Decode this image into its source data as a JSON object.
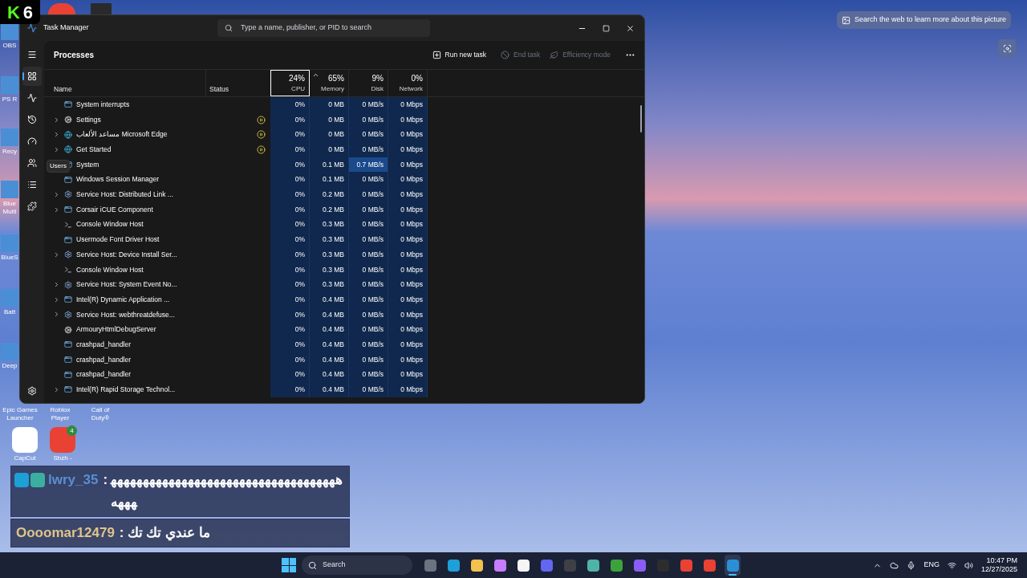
{
  "overlay_logo": {
    "letter": "K",
    "number": "6"
  },
  "desktop_icons": [
    {
      "label": "OBS"
    },
    {
      "label": "PS R"
    },
    {
      "label": "Recy"
    },
    {
      "label": "Blue Multi"
    },
    {
      "label": "BlueS"
    },
    {
      "label": "Batt"
    },
    {
      "label": "Deep"
    },
    {
      "label": "Epic Games Launcher"
    },
    {
      "label": "Roblox Player"
    },
    {
      "label": "Call of Duty®"
    },
    {
      "label": "CapCut"
    },
    {
      "label": "Sbzh -",
      "badge": "4"
    }
  ],
  "task_manager": {
    "title": "Task Manager",
    "search_placeholder": "Type a name, publisher, or PID to search",
    "sidebar": [
      {
        "kind": "processes",
        "selected": true
      },
      {
        "kind": "performance",
        "selected": false
      },
      {
        "kind": "history",
        "selected": false
      },
      {
        "kind": "startup",
        "selected": false
      },
      {
        "kind": "users",
        "selected": false
      },
      {
        "kind": "details",
        "selected": false
      },
      {
        "kind": "services",
        "selected": false
      }
    ],
    "tooltip": "Users",
    "page_title": "Processes",
    "toolbar": [
      {
        "label": "Run new task",
        "kind": "run",
        "disabled": false
      },
      {
        "label": "End task",
        "kind": "end",
        "disabled": true
      },
      {
        "label": "Efficiency mode",
        "kind": "eco",
        "disabled": true
      }
    ],
    "columns": {
      "name": "Name",
      "status": "Status"
    },
    "metrics": [
      {
        "percent": "24%",
        "label": "CPU",
        "selected": true,
        "sorted": false
      },
      {
        "percent": "65%",
        "label": "Memory",
        "selected": false,
        "sorted": true
      },
      {
        "percent": "9%",
        "label": "Disk",
        "selected": false,
        "sorted": false
      },
      {
        "percent": "0%",
        "label": "Network",
        "selected": false,
        "sorted": false
      }
    ],
    "rows": [
      {
        "name": "System interrupts",
        "kind": "app",
        "expandable": false,
        "paused": false,
        "cpu": "0%",
        "memory": "0 MB",
        "disk": "0 MB/s",
        "network": "0 Mbps",
        "disk_high": false
      },
      {
        "name": "Settings",
        "kind": "settings",
        "expandable": true,
        "paused": true,
        "cpu": "0%",
        "memory": "0 MB",
        "disk": "0 MB/s",
        "network": "0 Mbps",
        "disk_high": false
      },
      {
        "name": "مساعد الألعاب Microsoft Edge",
        "kind": "web",
        "expandable": true,
        "paused": true,
        "cpu": "0%",
        "memory": "0 MB",
        "disk": "0 MB/s",
        "network": "0 Mbps",
        "disk_high": false
      },
      {
        "name": "Get Started",
        "kind": "web",
        "expandable": true,
        "paused": true,
        "cpu": "0%",
        "memory": "0 MB",
        "disk": "0 MB/s",
        "network": "0 Mbps",
        "disk_high": false
      },
      {
        "name": "System",
        "kind": "app",
        "expandable": false,
        "paused": false,
        "cpu": "0%",
        "memory": "0.1 MB",
        "disk": "0.7 MB/s",
        "network": "0 Mbps",
        "disk_high": true
      },
      {
        "name": "Windows Session Manager",
        "kind": "app",
        "expandable": false,
        "paused": false,
        "cpu": "0%",
        "memory": "0.1 MB",
        "disk": "0 MB/s",
        "network": "0 Mbps",
        "disk_high": false
      },
      {
        "name": "Service Host: Distributed Link ...",
        "kind": "service",
        "expandable": true,
        "paused": false,
        "cpu": "0%",
        "memory": "0.2 MB",
        "disk": "0 MB/s",
        "network": "0 Mbps",
        "disk_high": false
      },
      {
        "name": "Corsair iCUE Component",
        "kind": "app",
        "expandable": true,
        "paused": false,
        "cpu": "0%",
        "memory": "0.2 MB",
        "disk": "0 MB/s",
        "network": "0 Mbps",
        "disk_high": false
      },
      {
        "name": "Console Window Host",
        "kind": "console",
        "expandable": false,
        "paused": false,
        "cpu": "0%",
        "memory": "0.3 MB",
        "disk": "0 MB/s",
        "network": "0 Mbps",
        "disk_high": false
      },
      {
        "name": "Usermode Font Driver Host",
        "kind": "app",
        "expandable": false,
        "paused": false,
        "cpu": "0%",
        "memory": "0.3 MB",
        "disk": "0 MB/s",
        "network": "0 Mbps",
        "disk_high": false
      },
      {
        "name": "Service Host: Device Install Ser...",
        "kind": "service",
        "expandable": true,
        "paused": false,
        "cpu": "0%",
        "memory": "0.3 MB",
        "disk": "0 MB/s",
        "network": "0 Mbps",
        "disk_high": false
      },
      {
        "name": "Console Window Host",
        "kind": "console",
        "expandable": false,
        "paused": false,
        "cpu": "0%",
        "memory": "0.3 MB",
        "disk": "0 MB/s",
        "network": "0 Mbps",
        "disk_high": false
      },
      {
        "name": "Service Host: System Event No...",
        "kind": "service",
        "expandable": true,
        "paused": false,
        "cpu": "0%",
        "memory": "0.3 MB",
        "disk": "0 MB/s",
        "network": "0 Mbps",
        "disk_high": false
      },
      {
        "name": "Intel(R) Dynamic Application ...",
        "kind": "app",
        "expandable": true,
        "paused": false,
        "cpu": "0%",
        "memory": "0.4 MB",
        "disk": "0 MB/s",
        "network": "0 Mbps",
        "disk_high": false
      },
      {
        "name": "Service Host: webthreatdefuse...",
        "kind": "service",
        "expandable": true,
        "paused": false,
        "cpu": "0%",
        "memory": "0.4 MB",
        "disk": "0 MB/s",
        "network": "0 Mbps",
        "disk_high": false
      },
      {
        "name": "ArmouryHtmlDebugServer",
        "kind": "settings",
        "expandable": false,
        "paused": false,
        "cpu": "0%",
        "memory": "0.4 MB",
        "disk": "0 MB/s",
        "network": "0 Mbps",
        "disk_high": false
      },
      {
        "name": "crashpad_handler",
        "kind": "app",
        "expandable": false,
        "paused": false,
        "cpu": "0%",
        "memory": "0.4 MB",
        "disk": "0 MB/s",
        "network": "0 Mbps",
        "disk_high": false
      },
      {
        "name": "crashpad_handler",
        "kind": "app",
        "expandable": false,
        "paused": false,
        "cpu": "0%",
        "memory": "0.4 MB",
        "disk": "0 MB/s",
        "network": "0 Mbps",
        "disk_high": false
      },
      {
        "name": "crashpad_handler",
        "kind": "app",
        "expandable": false,
        "paused": false,
        "cpu": "0%",
        "memory": "0.4 MB",
        "disk": "0 MB/s",
        "network": "0 Mbps",
        "disk_high": false
      },
      {
        "name": "Intel(R) Rapid Storage Technol...",
        "kind": "app",
        "expandable": true,
        "paused": false,
        "cpu": "0%",
        "memory": "0.4 MB",
        "disk": "0 MB/s",
        "network": "0 Mbps",
        "disk_high": false
      }
    ]
  },
  "web_search_button": "Search the web to learn more about this picture",
  "chat": {
    "separator": ":",
    "messages": [
      {
        "user": "lwry_35",
        "color": "#5b8fd0",
        "badges": [
          {
            "kind": "mod"
          },
          {
            "kind": "og"
          }
        ],
        "message": "هههههههههههههههههههههههههههههههههههههههه"
      },
      {
        "user": "Oooomar12479",
        "color": "#e0c589",
        "message": "ما عندي تك تك"
      }
    ]
  },
  "taskbar": {
    "search_placeholder": "Search",
    "apps": [
      {
        "kind": "taskview",
        "active": false
      },
      {
        "kind": "edge",
        "active": false
      },
      {
        "kind": "folder",
        "active": false
      },
      {
        "kind": "copilot",
        "active": false
      },
      {
        "kind": "store",
        "active": false
      },
      {
        "kind": "hex",
        "active": false
      },
      {
        "kind": "unity",
        "active": false
      },
      {
        "kind": "globe",
        "active": false
      },
      {
        "kind": "creeper",
        "active": false
      },
      {
        "kind": "chat",
        "active": false
      },
      {
        "kind": "obs",
        "active": false
      },
      {
        "kind": "chrome",
        "active": false
      },
      {
        "kind": "chrome",
        "active": false
      },
      {
        "kind": "taskmgr",
        "active": true
      }
    ],
    "language": "ENG",
    "time": "10:47 PM",
    "date": "12/27/2025"
  }
}
